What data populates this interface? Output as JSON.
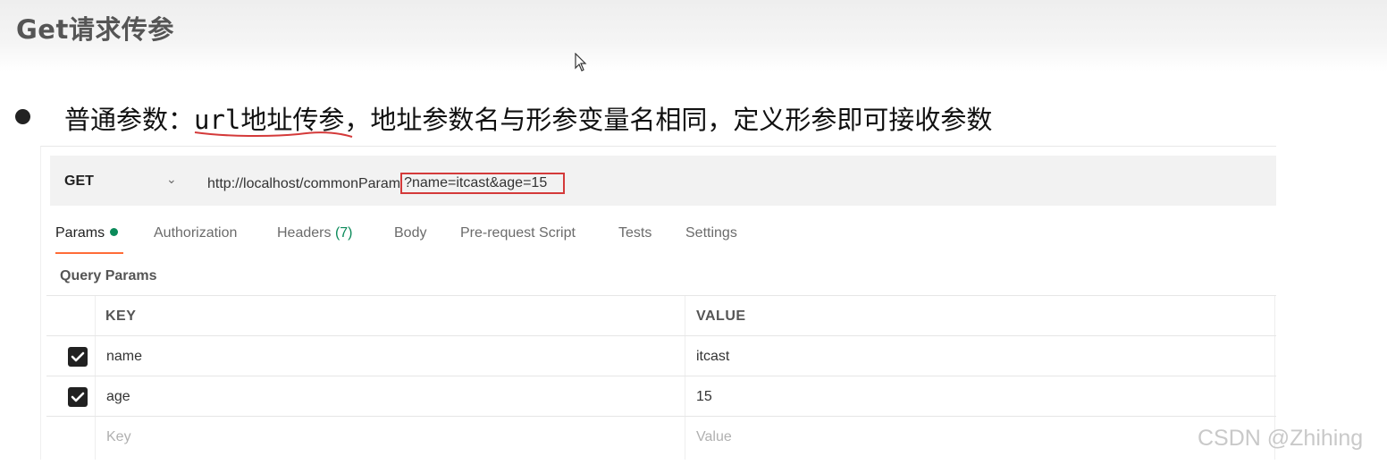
{
  "slide": {
    "title": "Get请求传参",
    "bullet_label": "普通参数：",
    "bullet_code": "url地址传参，",
    "bullet_rest": "地址参数名与形参变量名相同，定义形参即可接收参数"
  },
  "request": {
    "method": "GET",
    "url_base": "http://localhost/commonParam",
    "url_query": "?name=itcast&age=15"
  },
  "tabs": [
    {
      "label": "Params",
      "active": true
    },
    {
      "label": "Authorization"
    },
    {
      "label": "Headers",
      "count": "(7)"
    },
    {
      "label": "Body"
    },
    {
      "label": "Pre-request Script"
    },
    {
      "label": "Tests"
    },
    {
      "label": "Settings"
    }
  ],
  "query_params": {
    "label": "Query Params",
    "columns": [
      "KEY",
      "VALUE"
    ],
    "rows": [
      {
        "checked": true,
        "key": "name",
        "value": "itcast"
      },
      {
        "checked": true,
        "key": "age",
        "value": "15"
      }
    ],
    "placeholder": {
      "key": "Key",
      "value": "Value"
    }
  },
  "watermark": "CSDN @Zhihing",
  "colors": {
    "highlight_box": "#d43a3a",
    "active_tab_underline": "#ff6c37",
    "status_dot": "#0b8a5a",
    "annotation_line": "#d43a3a"
  }
}
